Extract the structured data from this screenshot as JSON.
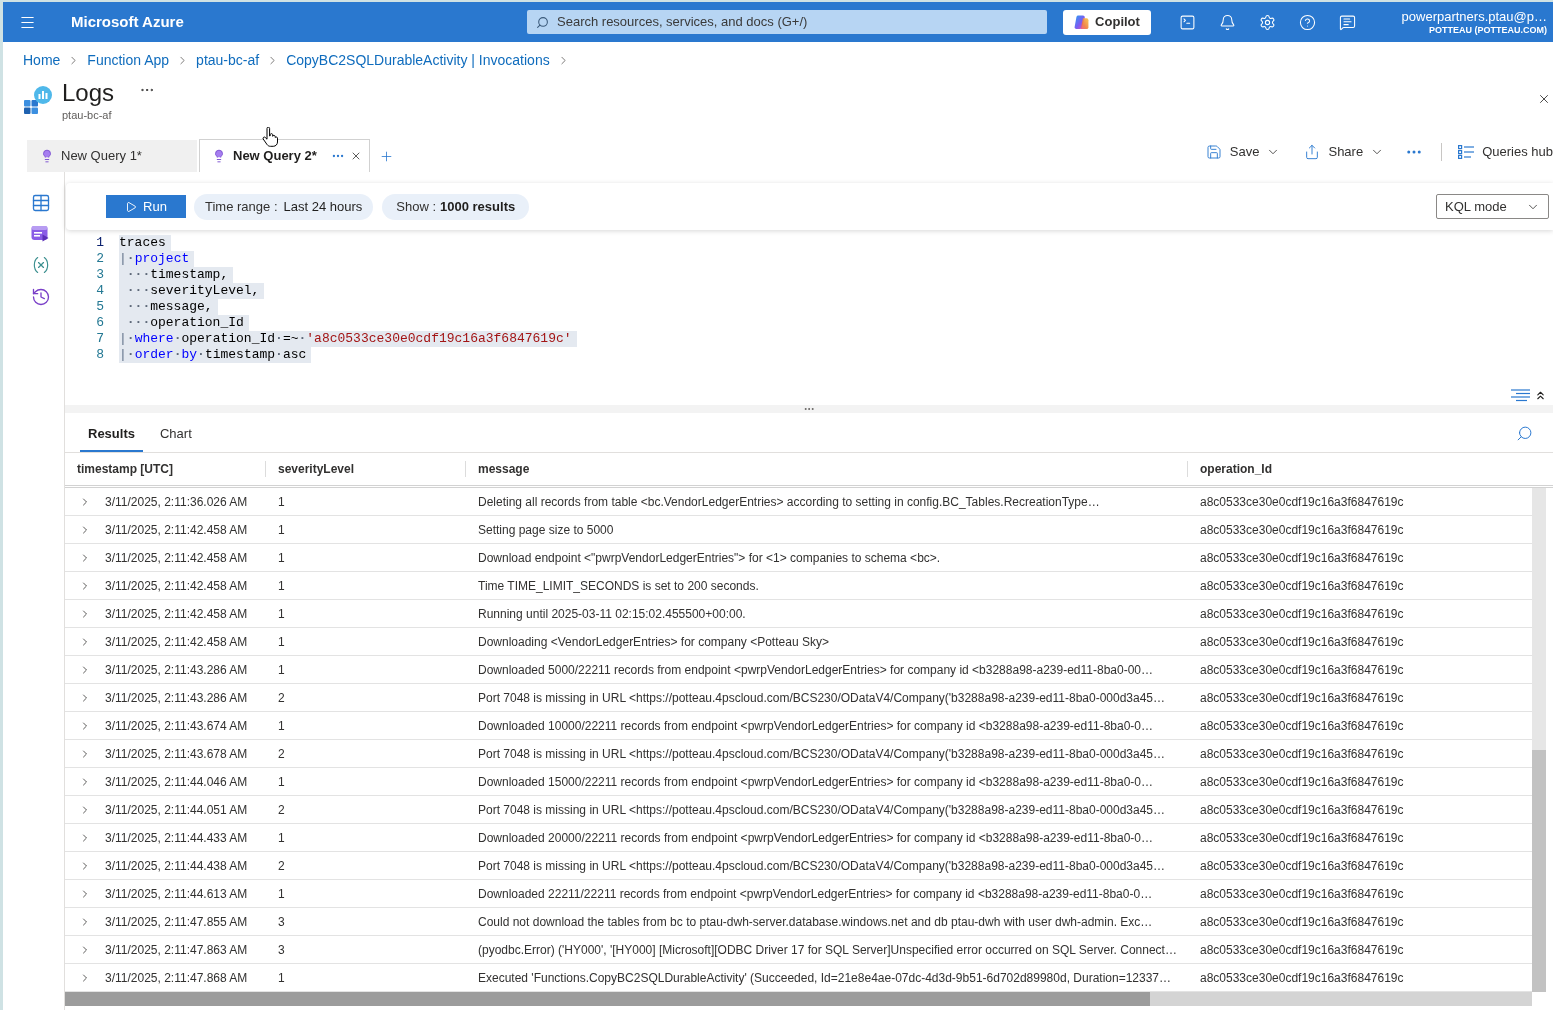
{
  "top_bar": {
    "brand": "Microsoft Azure",
    "search": {
      "placeholder": "Search resources, services, and docs (G+/)"
    },
    "copilot": "Copilot",
    "account": {
      "user": "powerpartners.ptau@p…",
      "tenant": "POTTEAU (POTTEAU.COM)"
    }
  },
  "breadcrumb": [
    "Home",
    "Function App",
    "ptau-bc-af",
    "CopyBC2SQLDurableActivity | Invocations"
  ],
  "page": {
    "title": "Logs",
    "subtitle": "ptau-bc-af"
  },
  "query_tabs": [
    {
      "label": "New Query 1*",
      "selected": false
    },
    {
      "label": "New Query 2*",
      "selected": true
    }
  ],
  "toolbar_actions": [
    {
      "kind": "save",
      "label": "Save",
      "has_menu": true
    },
    {
      "kind": "share",
      "label": "Share",
      "has_menu": true
    }
  ],
  "queries_hub": "Queries hub",
  "query_bar": {
    "run": "Run",
    "time_range": {
      "label": "Time range :",
      "value": "Last 24 hours"
    },
    "show": {
      "label": "Show :",
      "value": "1000 results"
    },
    "mode": "KQL mode"
  },
  "editor": {
    "lines": [
      {
        "number": "1",
        "current": true,
        "tokens": [
          {
            "kind": "text",
            "text": "traces"
          }
        ]
      },
      {
        "number": "2",
        "current": false,
        "tokens": [
          {
            "kind": "pipe",
            "text": "|"
          },
          {
            "kind": "space",
            "text": "·"
          },
          {
            "kind": "keyword",
            "text": "project"
          }
        ]
      },
      {
        "number": "3",
        "current": false,
        "tokens": [
          {
            "kind": "indent",
            "text": "···"
          },
          {
            "kind": "text",
            "text": "timestamp,"
          }
        ]
      },
      {
        "number": "4",
        "current": false,
        "tokens": [
          {
            "kind": "indent",
            "text": "···"
          },
          {
            "kind": "text",
            "text": "severityLevel,"
          }
        ]
      },
      {
        "number": "5",
        "current": false,
        "tokens": [
          {
            "kind": "indent",
            "text": "···"
          },
          {
            "kind": "text",
            "text": "message,"
          }
        ]
      },
      {
        "number": "6",
        "current": false,
        "tokens": [
          {
            "kind": "indent",
            "text": "···"
          },
          {
            "kind": "text",
            "text": "operation_Id"
          }
        ]
      },
      {
        "number": "7",
        "current": false,
        "tokens": [
          {
            "kind": "pipe",
            "text": "|"
          },
          {
            "kind": "space",
            "text": "·"
          },
          {
            "kind": "keyword",
            "text": "where"
          },
          {
            "kind": "space",
            "text": "·"
          },
          {
            "kind": "text",
            "text": "operation_Id"
          },
          {
            "kind": "space",
            "text": "·"
          },
          {
            "kind": "text",
            "text": "=~"
          },
          {
            "kind": "space",
            "text": "·"
          },
          {
            "kind": "string",
            "text": "'a8c0533ce30e0cdf19c16a3f6847619c'"
          }
        ]
      },
      {
        "number": "8",
        "current": false,
        "tokens": [
          {
            "kind": "pipe",
            "text": "|"
          },
          {
            "kind": "space",
            "text": "·"
          },
          {
            "kind": "keyword",
            "text": "order"
          },
          {
            "kind": "space",
            "text": "·"
          },
          {
            "kind": "keyword",
            "text": "by"
          },
          {
            "kind": "space",
            "text": "·"
          },
          {
            "kind": "text",
            "text": "timestamp"
          },
          {
            "kind": "space",
            "text": "·"
          },
          {
            "kind": "text",
            "text": "asc"
          }
        ]
      }
    ]
  },
  "results": {
    "tabs": [
      {
        "label": "Results",
        "selected": true
      },
      {
        "label": "Chart",
        "selected": false
      }
    ],
    "columns": [
      "timestamp [UTC]",
      "severityLevel",
      "message",
      "operation_Id"
    ],
    "rows": [
      {
        "timestamp": "3/11/2025, 2:11:36.026 AM",
        "severityLevel": "1",
        "message": "Deleting all records from table <bc.VendorLedgerEntries> according to setting in config.BC_Tables.RecreationType…",
        "operation_Id": "a8c0533ce30e0cdf19c16a3f6847619c"
      },
      {
        "timestamp": "3/11/2025, 2:11:42.458 AM",
        "severityLevel": "1",
        "message": "Setting page size to 5000",
        "operation_Id": "a8c0533ce30e0cdf19c16a3f6847619c"
      },
      {
        "timestamp": "3/11/2025, 2:11:42.458 AM",
        "severityLevel": "1",
        "message": "Download endpoint <\"pwrpVendorLedgerEntries\"> for <1> companies to schema <bc>.",
        "operation_Id": "a8c0533ce30e0cdf19c16a3f6847619c"
      },
      {
        "timestamp": "3/11/2025, 2:11:42.458 AM",
        "severityLevel": "1",
        "message": "Time TIME_LIMIT_SECONDS is set to 200 seconds.",
        "operation_Id": "a8c0533ce30e0cdf19c16a3f6847619c"
      },
      {
        "timestamp": "3/11/2025, 2:11:42.458 AM",
        "severityLevel": "1",
        "message": "Running until 2025-03-11 02:15:02.455500+00:00.",
        "operation_Id": "a8c0533ce30e0cdf19c16a3f6847619c"
      },
      {
        "timestamp": "3/11/2025, 2:11:42.458 AM",
        "severityLevel": "1",
        "message": "Downloading <VendorLedgerEntries> for company <Potteau Sky>",
        "operation_Id": "a8c0533ce30e0cdf19c16a3f6847619c"
      },
      {
        "timestamp": "3/11/2025, 2:11:43.286 AM",
        "severityLevel": "1",
        "message": "Downloaded 5000/22211 records from endpoint <pwrpVendorLedgerEntries> for company id <b3288a98-a239-ed11-8ba0-00…",
        "operation_Id": "a8c0533ce30e0cdf19c16a3f6847619c"
      },
      {
        "timestamp": "3/11/2025, 2:11:43.286 AM",
        "severityLevel": "2",
        "message": "Port 7048 is missing in URL <https://potteau.4pscloud.com/BCS230/ODataV4/Company('b3288a98-a239-ed11-8ba0-000d3a45…",
        "operation_Id": "a8c0533ce30e0cdf19c16a3f6847619c"
      },
      {
        "timestamp": "3/11/2025, 2:11:43.674 AM",
        "severityLevel": "1",
        "message": "Downloaded 10000/22211 records from endpoint <pwrpVendorLedgerEntries> for company id <b3288a98-a239-ed11-8ba0-0…",
        "operation_Id": "a8c0533ce30e0cdf19c16a3f6847619c"
      },
      {
        "timestamp": "3/11/2025, 2:11:43.678 AM",
        "severityLevel": "2",
        "message": "Port 7048 is missing in URL <https://potteau.4pscloud.com/BCS230/ODataV4/Company('b3288a98-a239-ed11-8ba0-000d3a45…",
        "operation_Id": "a8c0533ce30e0cdf19c16a3f6847619c"
      },
      {
        "timestamp": "3/11/2025, 2:11:44.046 AM",
        "severityLevel": "1",
        "message": "Downloaded 15000/22211 records from endpoint <pwrpVendorLedgerEntries> for company id <b3288a98-a239-ed11-8ba0-0…",
        "operation_Id": "a8c0533ce30e0cdf19c16a3f6847619c"
      },
      {
        "timestamp": "3/11/2025, 2:11:44.051 AM",
        "severityLevel": "2",
        "message": "Port 7048 is missing in URL <https://potteau.4pscloud.com/BCS230/ODataV4/Company('b3288a98-a239-ed11-8ba0-000d3a45…",
        "operation_Id": "a8c0533ce30e0cdf19c16a3f6847619c"
      },
      {
        "timestamp": "3/11/2025, 2:11:44.433 AM",
        "severityLevel": "1",
        "message": "Downloaded 20000/22211 records from endpoint <pwrpVendorLedgerEntries> for company id <b3288a98-a239-ed11-8ba0-0…",
        "operation_Id": "a8c0533ce30e0cdf19c16a3f6847619c"
      },
      {
        "timestamp": "3/11/2025, 2:11:44.438 AM",
        "severityLevel": "2",
        "message": "Port 7048 is missing in URL <https://potteau.4pscloud.com/BCS230/ODataV4/Company('b3288a98-a239-ed11-8ba0-000d3a45…",
        "operation_Id": "a8c0533ce30e0cdf19c16a3f6847619c"
      },
      {
        "timestamp": "3/11/2025, 2:11:44.613 AM",
        "severityLevel": "1",
        "message": "Downloaded 22211/22211 records from endpoint <pwrpVendorLedgerEntries> for company id <b3288a98-a239-ed11-8ba0-0…",
        "operation_Id": "a8c0533ce30e0cdf19c16a3f6847619c"
      },
      {
        "timestamp": "3/11/2025, 2:11:47.855 AM",
        "severityLevel": "3",
        "message": "Could not download the tables from bc to ptau-dwh-server.database.windows.net and db ptau-dwh with user dwh-admin. Exc…",
        "operation_Id": "a8c0533ce30e0cdf19c16a3f6847619c"
      },
      {
        "timestamp": "3/11/2025, 2:11:47.863 AM",
        "severityLevel": "3",
        "message": "(pyodbc.Error) ('HY000', '[HY000] [Microsoft][ODBC Driver 17 for SQL Server]Unspecified error occurred on SQL Server. Connect…",
        "operation_Id": "a8c0533ce30e0cdf19c16a3f6847619c"
      },
      {
        "timestamp": "3/11/2025, 2:11:47.868 AM",
        "severityLevel": "1",
        "message": "Executed 'Functions.CopyBC2SQLDurableActivity' (Succeeded, Id=21e8e4ae-07dc-4d3d-9b51-6d702d89980d, Duration=12337…",
        "operation_Id": "a8c0533ce30e0cdf19c16a3f6847619c"
      }
    ]
  }
}
